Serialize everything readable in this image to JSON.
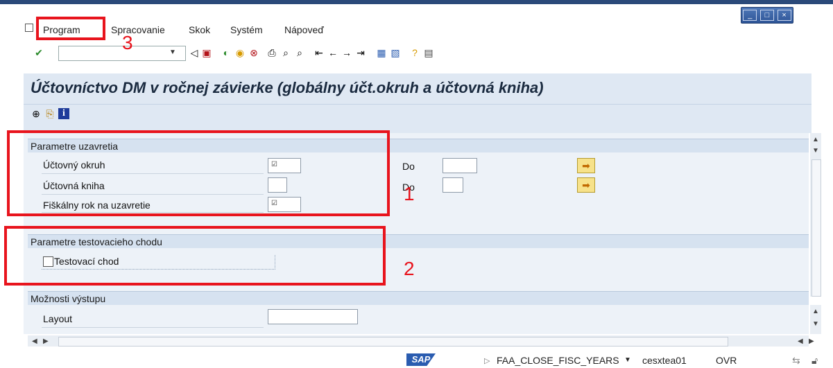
{
  "menu": {
    "items": [
      {
        "label": "Program"
      },
      {
        "label": "Spracovanie"
      },
      {
        "label": "Skok"
      },
      {
        "label": "Systém"
      },
      {
        "label": "Nápoveď"
      }
    ]
  },
  "header": {
    "title": "Účtovníctvo DM v ročnej závierke (globálny účt.okruh a účtovná kniha)"
  },
  "groups": {
    "closing": {
      "title": "Parametre uzavretia",
      "rows": [
        {
          "label": "Účtovný okruh",
          "to_label": "Do"
        },
        {
          "label": "Účtovná kniha",
          "to_label": "Do"
        },
        {
          "label": "Fiškálny rok na uzavretie"
        }
      ]
    },
    "test": {
      "title": "Parametre testovacieho chodu",
      "checkbox_label": "Testovací chod"
    },
    "output": {
      "title": "Možnosti výstupu",
      "layout_label": "Layout"
    }
  },
  "statusbar": {
    "transaction": "FAA_CLOSE_FISC_YEARS",
    "user": "cesxtea01",
    "mode": "OVR",
    "logo": "SAP"
  },
  "annotations": {
    "n1": "1",
    "n2": "2",
    "n3": "3",
    "color": "#e8141d"
  }
}
